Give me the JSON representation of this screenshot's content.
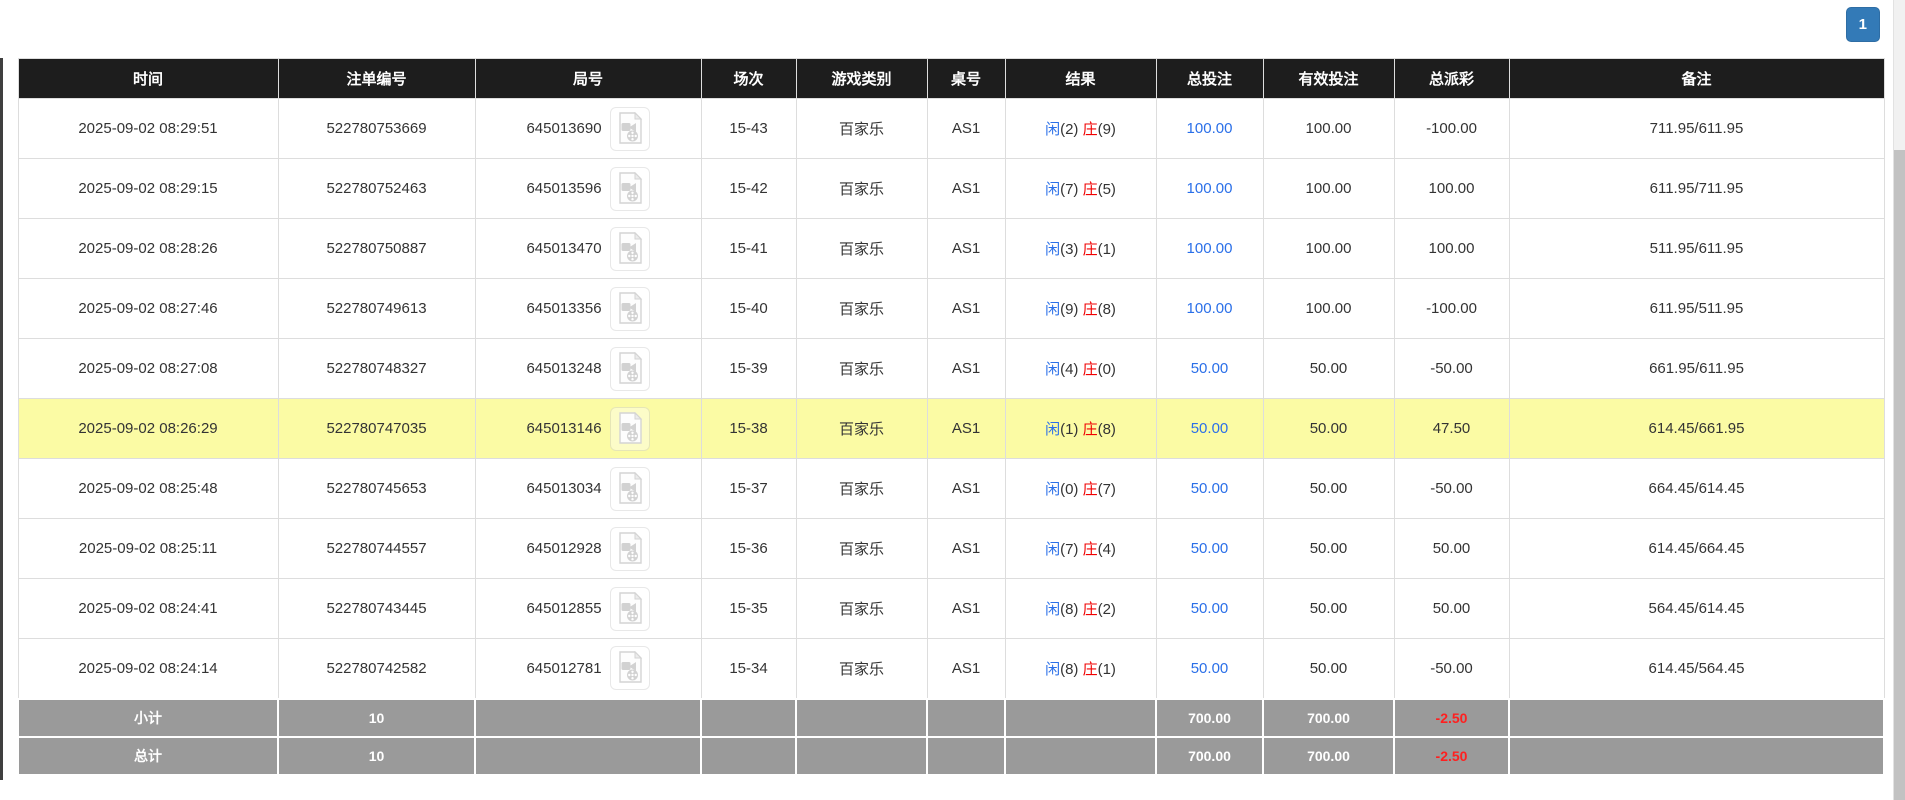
{
  "pagination": {
    "current_page": "1"
  },
  "colors": {
    "header_bg": "#1d1d1d",
    "highlight_row_bg": "#fbfba4",
    "footer_bg": "#9a9a9a",
    "link_blue": "#2a6fe8",
    "negative_red": "#f00000",
    "pager_blue": "#337ab7"
  },
  "table": {
    "columns": [
      {
        "key": "time",
        "label": "时间"
      },
      {
        "key": "bet-number",
        "label": "注单编号"
      },
      {
        "key": "round-number",
        "label": "局号"
      },
      {
        "key": "session",
        "label": "场次"
      },
      {
        "key": "game-type",
        "label": "游戏类别"
      },
      {
        "key": "table-number",
        "label": "桌号"
      },
      {
        "key": "result",
        "label": "结果"
      },
      {
        "key": "total-bet",
        "label": "总投注"
      },
      {
        "key": "valid-bet",
        "label": "有效投注"
      },
      {
        "key": "payout",
        "label": "总派彩"
      },
      {
        "key": "remark",
        "label": "备注"
      }
    ],
    "result_labels": {
      "player": "闲",
      "banker": "庄"
    },
    "icons": {
      "round_icon": "video-replay-icon"
    },
    "rows": [
      {
        "time": "2025-09-02 08:29:51",
        "bet_no": "522780753669",
        "round_no": "645013690",
        "session": "15-43",
        "game_type": "百家乐",
        "table_no": "AS1",
        "result": {
          "player": "2",
          "banker": "9"
        },
        "total_bet": "100.00",
        "valid_bet": "100.00",
        "payout": "-100.00",
        "remark": "711.95/611.95",
        "highlighted": false
      },
      {
        "time": "2025-09-02 08:29:15",
        "bet_no": "522780752463",
        "round_no": "645013596",
        "session": "15-42",
        "game_type": "百家乐",
        "table_no": "AS1",
        "result": {
          "player": "7",
          "banker": "5"
        },
        "total_bet": "100.00",
        "valid_bet": "100.00",
        "payout": "100.00",
        "remark": "611.95/711.95",
        "highlighted": false
      },
      {
        "time": "2025-09-02 08:28:26",
        "bet_no": "522780750887",
        "round_no": "645013470",
        "session": "15-41",
        "game_type": "百家乐",
        "table_no": "AS1",
        "result": {
          "player": "3",
          "banker": "1"
        },
        "total_bet": "100.00",
        "valid_bet": "100.00",
        "payout": "100.00",
        "remark": "511.95/611.95",
        "highlighted": false
      },
      {
        "time": "2025-09-02 08:27:46",
        "bet_no": "522780749613",
        "round_no": "645013356",
        "session": "15-40",
        "game_type": "百家乐",
        "table_no": "AS1",
        "result": {
          "player": "9",
          "banker": "8"
        },
        "total_bet": "100.00",
        "valid_bet": "100.00",
        "payout": "-100.00",
        "remark": "611.95/511.95",
        "highlighted": false
      },
      {
        "time": "2025-09-02 08:27:08",
        "bet_no": "522780748327",
        "round_no": "645013248",
        "session": "15-39",
        "game_type": "百家乐",
        "table_no": "AS1",
        "result": {
          "player": "4",
          "banker": "0"
        },
        "total_bet": "50.00",
        "valid_bet": "50.00",
        "payout": "-50.00",
        "remark": "661.95/611.95",
        "highlighted": false
      },
      {
        "time": "2025-09-02 08:26:29",
        "bet_no": "522780747035",
        "round_no": "645013146",
        "session": "15-38",
        "game_type": "百家乐",
        "table_no": "AS1",
        "result": {
          "player": "1",
          "banker": "8"
        },
        "total_bet": "50.00",
        "valid_bet": "50.00",
        "payout": "47.50",
        "remark": "614.45/661.95",
        "highlighted": true
      },
      {
        "time": "2025-09-02 08:25:48",
        "bet_no": "522780745653",
        "round_no": "645013034",
        "session": "15-37",
        "game_type": "百家乐",
        "table_no": "AS1",
        "result": {
          "player": "0",
          "banker": "7"
        },
        "total_bet": "50.00",
        "valid_bet": "50.00",
        "payout": "-50.00",
        "remark": "664.45/614.45",
        "highlighted": false
      },
      {
        "time": "2025-09-02 08:25:11",
        "bet_no": "522780744557",
        "round_no": "645012928",
        "session": "15-36",
        "game_type": "百家乐",
        "table_no": "AS1",
        "result": {
          "player": "7",
          "banker": "4"
        },
        "total_bet": "50.00",
        "valid_bet": "50.00",
        "payout": "50.00",
        "remark": "614.45/664.45",
        "highlighted": false
      },
      {
        "time": "2025-09-02 08:24:41",
        "bet_no": "522780743445",
        "round_no": "645012855",
        "session": "15-35",
        "game_type": "百家乐",
        "table_no": "AS1",
        "result": {
          "player": "8",
          "banker": "2"
        },
        "total_bet": "50.00",
        "valid_bet": "50.00",
        "payout": "50.00",
        "remark": "564.45/614.45",
        "highlighted": false
      },
      {
        "time": "2025-09-02 08:24:14",
        "bet_no": "522780742582",
        "round_no": "645012781",
        "session": "15-34",
        "game_type": "百家乐",
        "table_no": "AS1",
        "result": {
          "player": "8",
          "banker": "1"
        },
        "total_bet": "50.00",
        "valid_bet": "50.00",
        "payout": "-50.00",
        "remark": "614.45/564.45",
        "highlighted": false
      }
    ],
    "footer": [
      {
        "key": "subtotal",
        "label": "小计",
        "count": "10",
        "total_bet": "700.00",
        "valid_bet": "700.00",
        "payout": "-2.50"
      },
      {
        "key": "total",
        "label": "总计",
        "count": "10",
        "total_bet": "700.00",
        "valid_bet": "700.00",
        "payout": "-2.50"
      }
    ]
  }
}
